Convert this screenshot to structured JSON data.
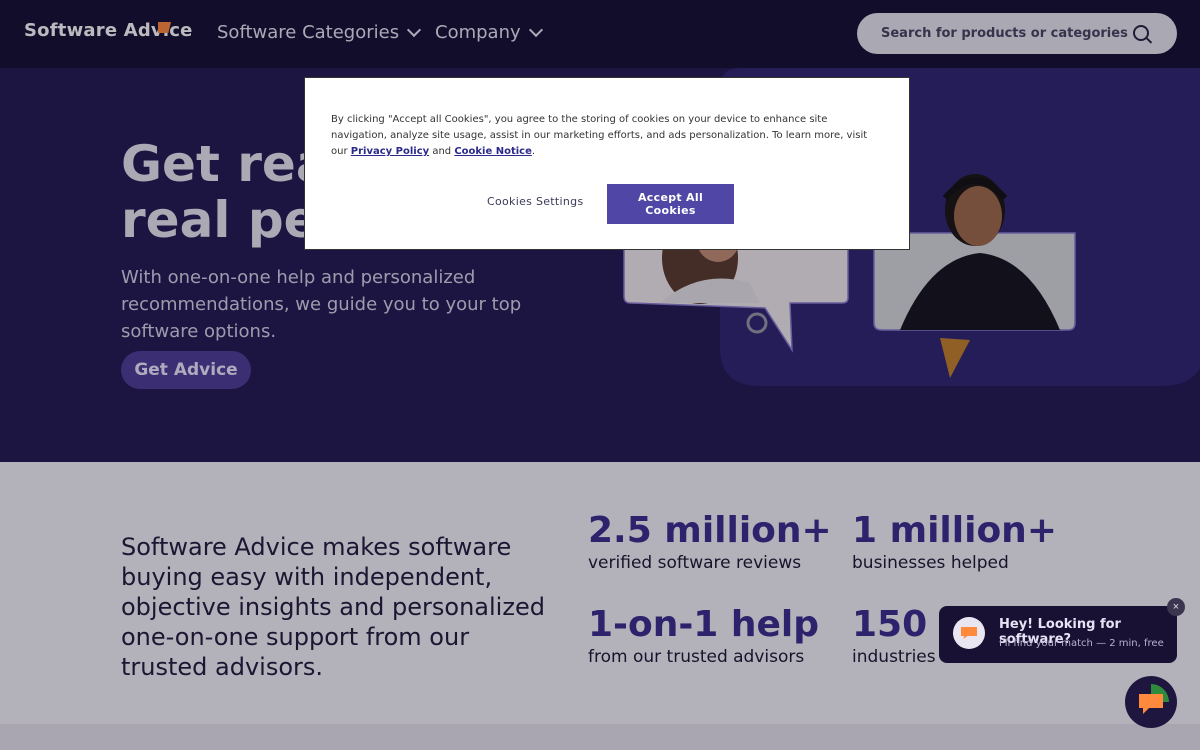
{
  "header": {
    "logo": "Software Advice",
    "nav": [
      "Software Categories",
      "Company"
    ],
    "search_placeholder": "Search for products or categories"
  },
  "hero": {
    "title_line1": "Get real",
    "title_line2": "real peop",
    "subtitle": "With one-on-one help and personalized recommendations, we guide you to your top software options.",
    "cta": "Get Advice"
  },
  "stats_section": {
    "intro": "Software Advice makes software buying easy with independent, objective insights and personalized one-on-one support from our trusted advisors.",
    "stats": [
      {
        "value": "2.5 million+",
        "label": "verified software reviews"
      },
      {
        "value": "1 million+",
        "label": "businesses helped"
      },
      {
        "value": "1-on-1 help",
        "label": "from our trusted advisors"
      },
      {
        "value": "150",
        "label": "industries covered"
      }
    ]
  },
  "cookie_dialog": {
    "text_before": "By clicking \"Accept all Cookies\", you agree to the storing of cookies on your device to enhance site navigation, analyze site usage, assist in our marketing efforts, and ads personalization. To learn more, visit our ",
    "privacy_link": "Privacy Policy",
    "and": " and ",
    "cookie_link": "Cookie Notice",
    "period": ".",
    "settings_button": "Cookies Settings",
    "accept_button": "Accept All Cookies"
  },
  "chat_widget": {
    "title": "Hey! Looking for software?",
    "subtitle": "I'll find your match — 2 min, free",
    "close": "×"
  },
  "colors": {
    "header_bg": "#161031",
    "hero_bg": "#231b53",
    "accent": "#4f46a6",
    "brand_orange": "#ff8a3d",
    "stat_color": "#3b2d8c"
  }
}
